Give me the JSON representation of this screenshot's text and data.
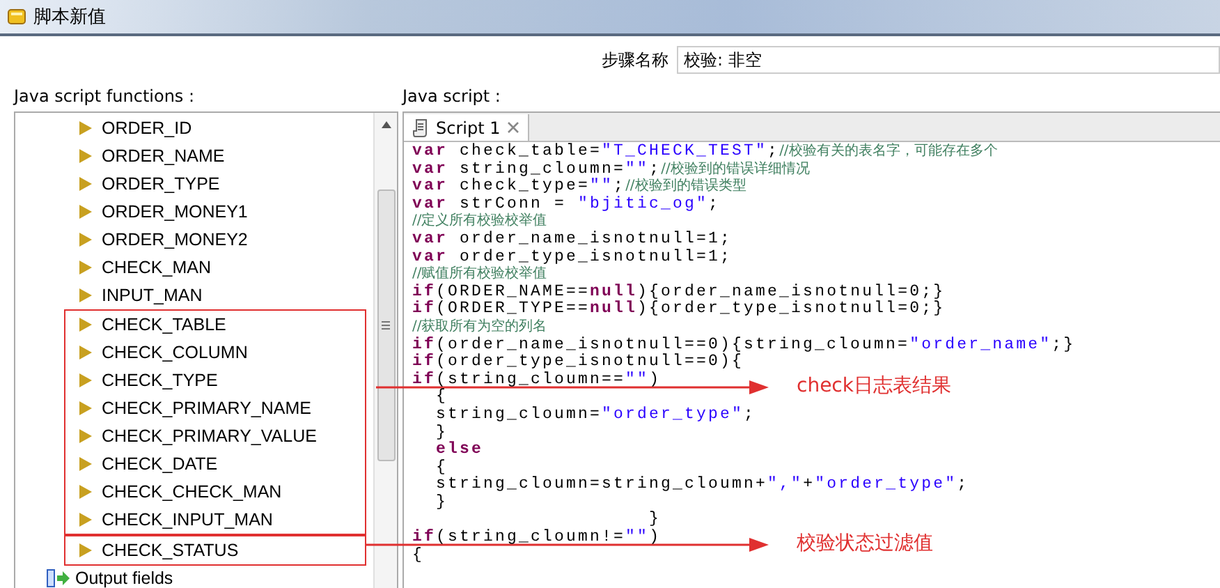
{
  "window": {
    "title": "脚本新值"
  },
  "step_name": {
    "label": "步骤名称",
    "value": "校验: 非空"
  },
  "functions_label": "Java script functions :",
  "script_label": "Java script :",
  "field_groups": [
    {
      "highlighted": false,
      "items": [
        {
          "label": "ORDER_ID"
        },
        {
          "label": "ORDER_NAME"
        },
        {
          "label": "ORDER_TYPE"
        },
        {
          "label": "ORDER_MONEY1"
        },
        {
          "label": "ORDER_MONEY2"
        },
        {
          "label": "CHECK_MAN"
        },
        {
          "label": "INPUT_MAN"
        }
      ]
    },
    {
      "highlighted": true,
      "items": [
        {
          "label": "CHECK_TABLE"
        },
        {
          "label": "CHECK_COLUMN"
        },
        {
          "label": "CHECK_TYPE"
        },
        {
          "label": "CHECK_PRIMARY_NAME"
        },
        {
          "label": "CHECK_PRIMARY_VALUE"
        },
        {
          "label": "CHECK_DATE"
        },
        {
          "label": "CHECK_CHECK_MAN"
        },
        {
          "label": "CHECK_INPUT_MAN"
        }
      ]
    },
    {
      "highlighted": true,
      "items": [
        {
          "label": "CHECK_STATUS"
        }
      ]
    }
  ],
  "output_fields": {
    "label": "Output fields"
  },
  "tabs": [
    {
      "label": "Script 1",
      "selected": true
    }
  ],
  "code_lines": [
    [
      {
        "kind": "kw",
        "text": "var"
      },
      {
        "kind": "tx",
        "text": " check_table="
      },
      {
        "kind": "str",
        "text": "\"T_CHECK_TEST\""
      },
      {
        "kind": "tx",
        "text": ";"
      },
      {
        "kind": "cm",
        "text": "//校验有关的表名字，可能存在多个"
      }
    ],
    [
      {
        "kind": "kw",
        "text": "var"
      },
      {
        "kind": "tx",
        "text": " string_cloumn="
      },
      {
        "kind": "str",
        "text": "\"\""
      },
      {
        "kind": "tx",
        "text": ";"
      },
      {
        "kind": "cm",
        "text": "//校验到的错误详细情况"
      }
    ],
    [
      {
        "kind": "kw",
        "text": "var"
      },
      {
        "kind": "tx",
        "text": " check_type="
      },
      {
        "kind": "str",
        "text": "\"\""
      },
      {
        "kind": "tx",
        "text": ";"
      },
      {
        "kind": "cm",
        "text": "//校验到的错误类型"
      }
    ],
    [
      {
        "kind": "kw",
        "text": "var"
      },
      {
        "kind": "tx",
        "text": " strConn = "
      },
      {
        "kind": "str",
        "text": "\"bjitic_og\""
      },
      {
        "kind": "tx",
        "text": ";"
      }
    ],
    [
      {
        "kind": "cm",
        "text": "//定义所有校验校举值"
      }
    ],
    [
      {
        "kind": "kw",
        "text": "var"
      },
      {
        "kind": "tx",
        "text": " order_name_isnotnull=1;"
      }
    ],
    [
      {
        "kind": "kw",
        "text": "var"
      },
      {
        "kind": "tx",
        "text": " order_type_isnotnull=1;"
      }
    ],
    [
      {
        "kind": "cm",
        "text": "//赋值所有校验校举值"
      }
    ],
    [
      {
        "kind": "kw",
        "text": "if"
      },
      {
        "kind": "tx",
        "text": "(ORDER_NAME=="
      },
      {
        "kind": "kw",
        "text": "null"
      },
      {
        "kind": "tx",
        "text": "){order_name_isnotnull=0;}"
      }
    ],
    [
      {
        "kind": "kw",
        "text": "if"
      },
      {
        "kind": "tx",
        "text": "(ORDER_TYPE=="
      },
      {
        "kind": "kw",
        "text": "null"
      },
      {
        "kind": "tx",
        "text": "){order_type_isnotnull=0;}"
      }
    ],
    [
      {
        "kind": "cm",
        "text": "//获取所有为空的列名"
      }
    ],
    [
      {
        "kind": "kw",
        "text": "if"
      },
      {
        "kind": "tx",
        "text": "(order_name_isnotnull==0){string_cloumn="
      },
      {
        "kind": "str",
        "text": "\"order_name\""
      },
      {
        "kind": "tx",
        "text": ";}"
      }
    ],
    [
      {
        "kind": "kw",
        "text": "if"
      },
      {
        "kind": "tx",
        "text": "(order_type_isnotnull==0){"
      }
    ],
    [
      {
        "kind": "kw",
        "text": "if"
      },
      {
        "kind": "tx",
        "text": "(string_cloumn=="
      },
      {
        "kind": "str",
        "text": "\"\""
      },
      {
        "kind": "tx",
        "text": ")"
      }
    ],
    [
      {
        "kind": "tx",
        "text": "  {"
      }
    ],
    [
      {
        "kind": "tx",
        "text": "  string_cloumn="
      },
      {
        "kind": "str",
        "text": "\"order_type\""
      },
      {
        "kind": "tx",
        "text": ";"
      }
    ],
    [
      {
        "kind": "tx",
        "text": "  }"
      }
    ],
    [
      {
        "kind": "kw",
        "text": "  else"
      }
    ],
    [
      {
        "kind": "tx",
        "text": "  {"
      }
    ],
    [
      {
        "kind": "tx",
        "text": "  string_cloumn=string_cloumn+"
      },
      {
        "kind": "str",
        "text": "\",\""
      },
      {
        "kind": "tx",
        "text": "+"
      },
      {
        "kind": "str",
        "text": "\"order_type\""
      },
      {
        "kind": "tx",
        "text": ";"
      }
    ],
    [
      {
        "kind": "tx",
        "text": "  }"
      }
    ],
    [
      {
        "kind": "tx",
        "text": "                    }"
      }
    ],
    [
      {
        "kind": "kw",
        "text": "if"
      },
      {
        "kind": "tx",
        "text": "(string_cloumn!="
      },
      {
        "kind": "str",
        "text": "\"\""
      },
      {
        "kind": "tx",
        "text": ")"
      }
    ],
    [
      {
        "kind": "tx",
        "text": "{"
      }
    ]
  ],
  "annotations": [
    {
      "text": "check日志表结果"
    },
    {
      "text": "校验状态过滤值"
    }
  ]
}
